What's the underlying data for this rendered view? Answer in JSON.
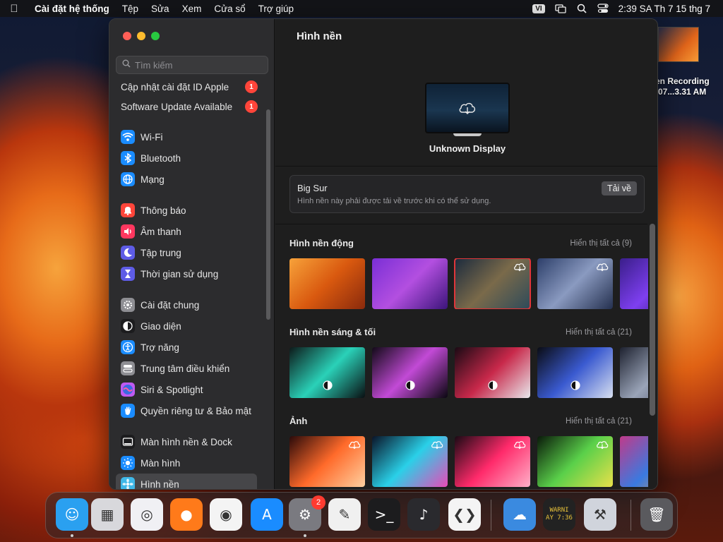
{
  "menubar": {
    "app_name": "Cài đặt hệ thống",
    "menus": [
      "Tệp",
      "Sửa",
      "Xem",
      "Cửa sổ",
      "Trợ giúp"
    ],
    "input_source": "VI",
    "clock": "2:39 SA Th 7 15 thg 7"
  },
  "desktop": {
    "recording_label_line1": "en Recording",
    "recording_label_line2": "-07...3.31 AM"
  },
  "window": {
    "search_placeholder": "Tìm kiếm",
    "updates": [
      {
        "label": "Cập nhật cài đặt ID Apple",
        "badge": "1"
      },
      {
        "label": "Software Update Available",
        "badge": "1"
      }
    ],
    "sidebar_groups": [
      [
        {
          "label": "Wi-Fi",
          "icon": "wifi-icon",
          "color": "#1a8cff"
        },
        {
          "label": "Bluetooth",
          "icon": "bluetooth-icon",
          "color": "#1a8cff"
        },
        {
          "label": "Mạng",
          "icon": "globe-icon",
          "color": "#1a8cff"
        }
      ],
      [
        {
          "label": "Thông báo",
          "icon": "bell-icon",
          "color": "#ff453a"
        },
        {
          "label": "Âm thanh",
          "icon": "speaker-icon",
          "color": "#ff375f"
        },
        {
          "label": "Tập trung",
          "icon": "moon-icon",
          "color": "#5e5ce6"
        },
        {
          "label": "Thời gian sử dụng",
          "icon": "hourglass-icon",
          "color": "#5e5ce6"
        }
      ],
      [
        {
          "label": "Cài đặt chung",
          "icon": "gear-icon",
          "color": "#8e8e93"
        },
        {
          "label": "Giao diện",
          "icon": "appearance-icon",
          "color": "#1c1c1e"
        },
        {
          "label": "Trợ năng",
          "icon": "accessibility-icon",
          "color": "#1a8cff"
        },
        {
          "label": "Trung tâm điều khiển",
          "icon": "control-center-icon",
          "color": "#8e8e93"
        },
        {
          "label": "Siri & Spotlight",
          "icon": "siri-icon",
          "color": "#bf5af2"
        },
        {
          "label": "Quyền riêng tư & Bảo mật",
          "icon": "hand-icon",
          "color": "#1a8cff"
        }
      ],
      [
        {
          "label": "Màn hình nền & Dock",
          "icon": "dock-icon",
          "color": "#1c1c1e"
        },
        {
          "label": "Màn hình",
          "icon": "sun-icon",
          "color": "#1a8cff"
        },
        {
          "label": "Hình nền",
          "icon": "wallpaper-icon",
          "color": "#3fb8e8",
          "selected": true
        }
      ]
    ],
    "content": {
      "title": "Hình nền",
      "display_name": "Unknown Display",
      "bigsur": {
        "title": "Big Sur",
        "description": "Hình nền này phải được tải về trước khi có thể sử dụng.",
        "button": "Tải về"
      },
      "sections": [
        {
          "title": "Hình nền động",
          "link": "Hiển thị tất cả (9)",
          "thumbs": [
            {
              "colors": [
                "#f7a23a",
                "#d9590f",
                "#8a2a0c"
              ],
              "cloud": false,
              "mode": false,
              "selected": false
            },
            {
              "colors": [
                "#7a2fd6",
                "#b34fe0",
                "#3b157a"
              ],
              "cloud": false,
              "mode": false,
              "selected": false
            },
            {
              "colors": [
                "#1b2a3d",
                "#7a6a4a",
                "#2d4a5a"
              ],
              "cloud": true,
              "mode": false,
              "selected": true
            },
            {
              "colors": [
                "#2d3f6a",
                "#8a9ac0",
                "#24304f"
              ],
              "cloud": true,
              "mode": false,
              "selected": false
            },
            {
              "colors": [
                "#3a1e8a",
                "#7e3ff0",
                "#1f0f55"
              ],
              "cloud": false,
              "mode": false,
              "selected": false
            }
          ]
        },
        {
          "title": "Hình nền sáng & tối",
          "link": "Hiển thị tất cả (21)",
          "thumbs": [
            {
              "colors": [
                "#0d1a1a",
                "#2ad1b8",
                "#0a0f12"
              ],
              "cloud": false,
              "mode": true,
              "selected": false
            },
            {
              "colors": [
                "#120a18",
                "#c24ad6",
                "#0a0710"
              ],
              "cloud": false,
              "mode": true,
              "selected": false
            },
            {
              "colors": [
                "#1a0a14",
                "#c8284a",
                "#e8e8ec"
              ],
              "cloud": false,
              "mode": true,
              "selected": false
            },
            {
              "colors": [
                "#0a0c14",
                "#3a5ad0",
                "#d8e0f0"
              ],
              "cloud": false,
              "mode": true,
              "selected": false
            },
            {
              "colors": [
                "#1e2230",
                "#9aa4b8",
                "#3a4258"
              ],
              "cloud": false,
              "mode": false,
              "selected": false
            }
          ]
        },
        {
          "title": "Ảnh",
          "link": "Hiển thị tất cả (21)",
          "thumbs": [
            {
              "colors": [
                "#2a0a0a",
                "#ff6a2a",
                "#ffd0a0"
              ],
              "cloud": true,
              "mode": false,
              "selected": false
            },
            {
              "colors": [
                "#0a1428",
                "#2ad0e8",
                "#e84ab8"
              ],
              "cloud": true,
              "mode": false,
              "selected": false
            },
            {
              "colors": [
                "#1a0a14",
                "#ff2a6a",
                "#ffb0c8"
              ],
              "cloud": true,
              "mode": false,
              "selected": false
            },
            {
              "colors": [
                "#0a1a0a",
                "#5ad04a",
                "#e8e04a"
              ],
              "cloud": true,
              "mode": false,
              "selected": false
            },
            {
              "colors": [
                "#c03a8a",
                "#3a7ae0",
                "#f0a03a"
              ],
              "cloud": false,
              "mode": false,
              "selected": false
            }
          ]
        }
      ]
    }
  },
  "dock": {
    "apps": [
      {
        "name": "finder-icon",
        "color": "#2aa0f0",
        "glyph": "☺",
        "dot": true
      },
      {
        "name": "launchpad-icon",
        "color": "#d8d8dc",
        "glyph": "▦",
        "dot": false
      },
      {
        "name": "safari-icon",
        "color": "#f0f0f4",
        "glyph": "◎",
        "dot": false
      },
      {
        "name": "firefox-icon",
        "color": "#ff7a1a",
        "glyph": "●",
        "dot": false
      },
      {
        "name": "chrome-icon",
        "color": "#f4f4f4",
        "glyph": "◉",
        "dot": false
      },
      {
        "name": "app-store-icon",
        "color": "#1a8cff",
        "glyph": "A",
        "dot": false
      },
      {
        "name": "system-settings-icon",
        "color": "#7a7a80",
        "glyph": "⚙",
        "dot": true,
        "badge": "2"
      },
      {
        "name": "textedit-icon",
        "color": "#f0f0f0",
        "glyph": "✎",
        "dot": false
      },
      {
        "name": "terminal-icon",
        "color": "#1c1c1e",
        "glyph": ">_",
        "dot": false
      },
      {
        "name": "garageband-icon",
        "color": "#2a2a2e",
        "glyph": "♪",
        "dot": false
      },
      {
        "name": "vscode-icon",
        "color": "#f4f4f4",
        "glyph": "❮❯",
        "dot": false
      },
      {
        "name": "weather-icon",
        "color": "#3a8ae0",
        "glyph": "☁",
        "dot": false
      },
      {
        "name": "console-icon",
        "color": "#222",
        "glyph": "WARNI",
        "dot": false
      },
      {
        "name": "automator-icon",
        "color": "#d0d4dc",
        "glyph": "⚒",
        "dot": false
      },
      {
        "name": "trash-icon",
        "color": "#5a5a5e",
        "glyph": "🗑",
        "dot": false
      }
    ],
    "console_text_line1": "WARNI",
    "console_text_line2": "AY 7:36"
  }
}
